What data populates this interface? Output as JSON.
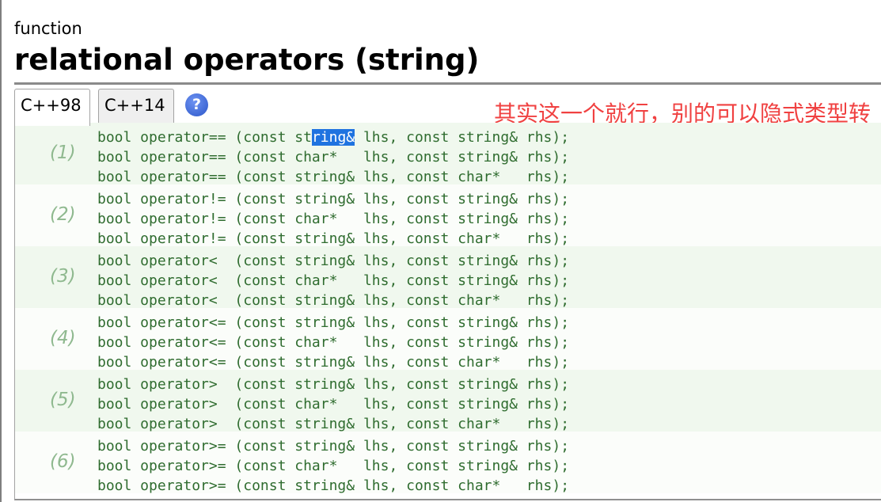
{
  "page": {
    "kind": "function",
    "title": "relational operators (string)"
  },
  "tabs": [
    {
      "label": "C++98",
      "active": true
    },
    {
      "label": "C++14",
      "active": false
    }
  ],
  "help_icon": {
    "glyph": "?",
    "color": "#2b56c9"
  },
  "annotation": "其实这一个就行，别的可以隐式类型转",
  "groups": [
    {
      "label": "(1)",
      "lines": [
        "bool operator== (const string& lhs, const string& rhs);",
        "bool operator== (const char*   lhs, const string& rhs);",
        "bool operator== (const string& lhs, const char*   rhs);"
      ]
    },
    {
      "label": "(2)",
      "lines": [
        "bool operator!= (const string& lhs, const string& rhs);",
        "bool operator!= (const char*   lhs, const string& rhs);",
        "bool operator!= (const string& lhs, const char*   rhs);"
      ]
    },
    {
      "label": "(3)",
      "lines": [
        "bool operator<  (const string& lhs, const string& rhs);",
        "bool operator<  (const char*   lhs, const string& rhs);",
        "bool operator<  (const string& lhs, const char*   rhs);"
      ]
    },
    {
      "label": "(4)",
      "lines": [
        "bool operator<= (const string& lhs, const string& rhs);",
        "bool operator<= (const char*   lhs, const string& rhs);",
        "bool operator<= (const string& lhs, const char*   rhs);"
      ]
    },
    {
      "label": "(5)",
      "lines": [
        "bool operator>  (const string& lhs, const string& rhs);",
        "bool operator>  (const char*   lhs, const string& rhs);",
        "bool operator>  (const string& lhs, const char*   rhs);"
      ]
    },
    {
      "label": "(6)",
      "lines": [
        "bool operator>= (const string& lhs, const string& rhs);",
        "bool operator>= (const char*   lhs, const string& rhs);",
        "bool operator>= (const string& lhs, const char*   rhs);"
      ]
    }
  ],
  "selection": {
    "text": "ring&"
  },
  "colors": {
    "code_text": "#2f6c2f",
    "group_label": "#8fb98f",
    "annotation": "#f04141",
    "selection_bg": "#1f73e0",
    "row_shade": "#f0f8ee"
  }
}
